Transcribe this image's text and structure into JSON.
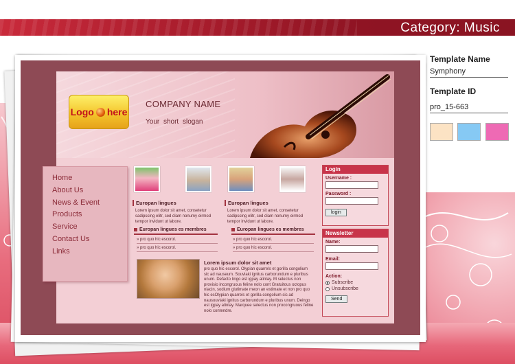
{
  "header": {
    "category": "Category: Music"
  },
  "template": {
    "company_name": "COMPANY NAME",
    "slogan": "Your short slogan",
    "logo_text_1": "Logo",
    "logo_text_2": "here",
    "nav": [
      "Home",
      "About Us",
      "News & Event",
      "Products",
      "Service",
      "Contact Us",
      "Links"
    ],
    "columns": [
      {
        "title": "Europan lingues",
        "text": "Lorem ipsum dolor sit amet, consetetur sadipscing elitr, sed diam nonumy eirmod tempor invidunt ut labore.",
        "bar": "Europan lingues es membres",
        "bullets": [
          "» pro quo hic escorol.",
          "» pro quo hic escorol."
        ]
      },
      {
        "title": "Europan lingues",
        "text": "Lorem ipsum dolor sit amet, consetetur sadipscing elitr, sed diam nonumy eirmod tempor invidunt ut labore.",
        "bar": "Europan lingues es membres",
        "bullets": [
          "» pro quo hic escorol.",
          "» pro quo hic escorol."
        ]
      }
    ],
    "feature": {
      "title": "Lorem ipsum dolor sit amet",
      "text": "pro quo hic escorol. Olypian quarrels et gorilla congolium sic ad nauseum. Souvlaki ignitus carborundum e pluribus unum. Defacto lingo est igpay atinlay. M selectus non provisio incongruous feline nolo cont Gratuitous octopus niacin, sodium glutimate meon an estimate et non pro quo hic esOlypian quarrels et gorilla congolium sic ad nausouvlaki ignitus carborundum e pluribus unum. Deingo est igpay atinlay. Marquee selectus non procongruous feline nolo contendre."
    },
    "login": {
      "heading": "Login",
      "username_label": "Username :",
      "password_label": "Password :",
      "button": "login"
    },
    "newsletter": {
      "heading": "Newsletter",
      "name_label": "Name:",
      "email_label": "Email:",
      "action_label": "Action:",
      "subscribe": "Subscribe",
      "unsubscribe": "Unsubscribe",
      "button": "Send"
    }
  },
  "info": {
    "name_label": "Template Name",
    "name_value": "Symphony",
    "id_label": "Template ID",
    "id_value": "pro_15-663",
    "swatches": [
      "#fce3c4",
      "#86c9f4",
      "#ee6ab4"
    ]
  },
  "colors": {
    "band": "#a71c2c",
    "frame": "#8e4a55",
    "nav_text": "#8b2b38",
    "box_head": "#c8344a"
  }
}
